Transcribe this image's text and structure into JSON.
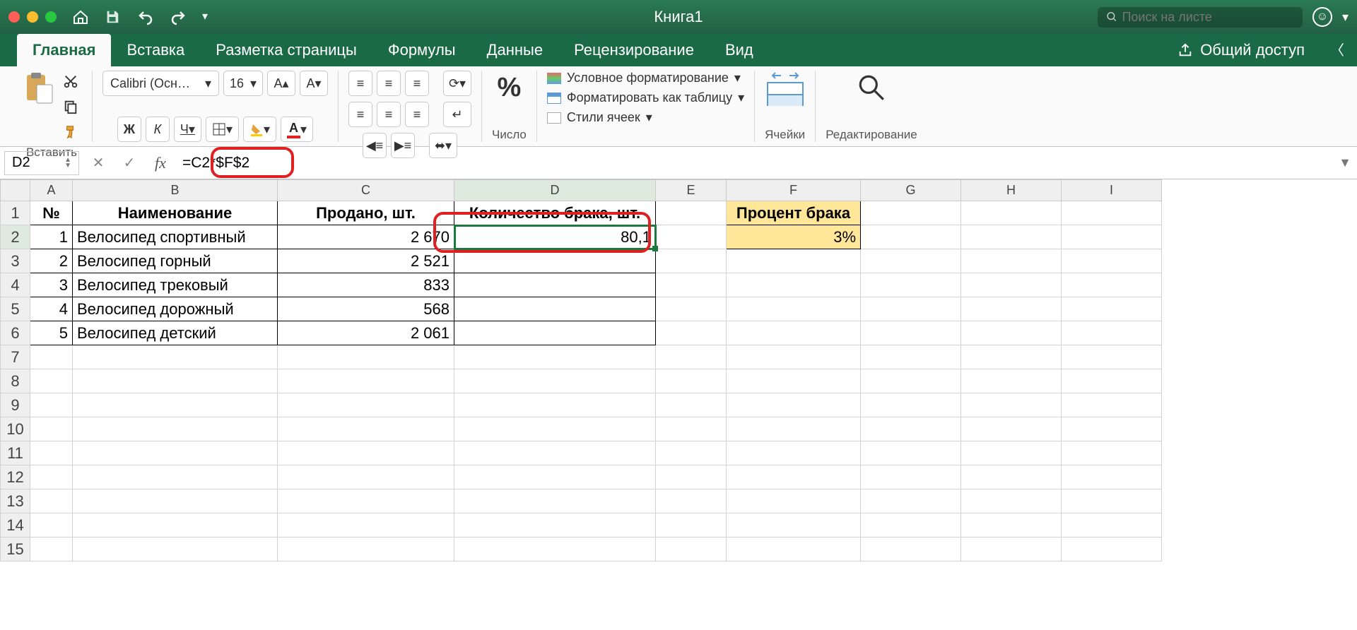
{
  "title": "Книга1",
  "search_placeholder": "Поиск на листе",
  "tabs": [
    "Главная",
    "Вставка",
    "Разметка страницы",
    "Формулы",
    "Данные",
    "Рецензирование",
    "Вид"
  ],
  "share_label": "Общий доступ",
  "ribbon": {
    "paste_label": "Вставить",
    "font_name": "Calibri (Осн…",
    "font_size": "16",
    "bold": "Ж",
    "italic": "К",
    "underline": "Ч",
    "number_label": "Число",
    "cond_fmt": "Условное форматирование",
    "fmt_table": "Форматировать как таблицу",
    "cell_styles": "Стили ячеек",
    "cells_label": "Ячейки",
    "editing_label": "Редактирование"
  },
  "formula_bar": {
    "cell_ref": "D2",
    "formula": "=C2*$F$2"
  },
  "columns": [
    "A",
    "B",
    "C",
    "D",
    "E",
    "F",
    "G",
    "H",
    "I"
  ],
  "row_nums": [
    1,
    2,
    3,
    4,
    5,
    6,
    7,
    8,
    9,
    10,
    11,
    12,
    13,
    14,
    15
  ],
  "headers": {
    "A": "№",
    "B": "Наименование",
    "C": "Продано, шт.",
    "D": "Количество брака, шт.",
    "F": "Процент брака"
  },
  "percent_value": "3%",
  "rows": [
    {
      "n": "1",
      "name": "Велосипед спортивный",
      "sold": "2 670",
      "defect": "80,1"
    },
    {
      "n": "2",
      "name": "Велосипед горный",
      "sold": "2 521",
      "defect": ""
    },
    {
      "n": "3",
      "name": "Велосипед трековый",
      "sold": "833",
      "defect": ""
    },
    {
      "n": "4",
      "name": "Велосипед дорожный",
      "sold": "568",
      "defect": ""
    },
    {
      "n": "5",
      "name": "Велосипед детский",
      "sold": "2 061",
      "defect": ""
    }
  ]
}
